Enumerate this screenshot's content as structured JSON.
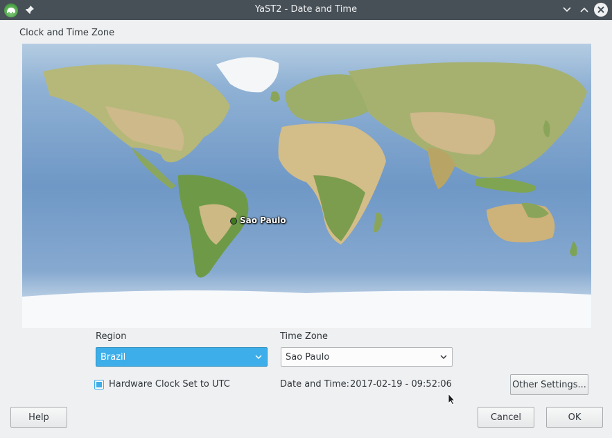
{
  "window": {
    "title": "YaST2 - Date and Time",
    "app_icon": "yast-chameleon-icon",
    "pin_icon": "pin-icon",
    "controls": [
      "minimize",
      "maximize",
      "close"
    ]
  },
  "section": {
    "label": "Clock and Time Zone"
  },
  "map": {
    "selected_city": "Sao Paulo"
  },
  "region": {
    "label": "Region",
    "value": "Brazil"
  },
  "timezone": {
    "label": "Time Zone",
    "value": "Sao Paulo"
  },
  "hardware_clock": {
    "label": "Hardware Clock Set to UTC",
    "checked": true
  },
  "datetime": {
    "label": "Date and Time:",
    "value": "2017-02-19 - 09:52:06"
  },
  "buttons": {
    "other_settings": "Other Settings...",
    "help": "Help",
    "cancel": "Cancel",
    "ok": "OK"
  },
  "colors": {
    "accent": "#3daee9",
    "titlebar": "#475057",
    "background": "#eff0f1"
  }
}
